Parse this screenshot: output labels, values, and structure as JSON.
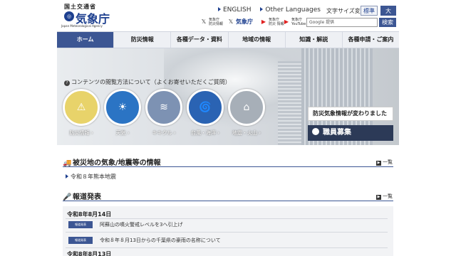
{
  "header": {
    "ministry": "国土交通省",
    "agency": "気象庁",
    "agency_en": "Japan Meteorological Agency",
    "links": {
      "english": "ENGLISH",
      "other_languages": "Other Languages"
    },
    "font_size_label": "文字サイズ変更",
    "font_standard": "標準",
    "font_large": "大",
    "social": [
      {
        "icon": "x-icon",
        "label": "気象庁\n防災情報"
      },
      {
        "icon": "x-icon",
        "label": "気象庁"
      },
      {
        "icon": "youtube-icon",
        "label": "気象庁\n防災 情報"
      },
      {
        "icon": "youtube-icon",
        "label": "気象庁\nYouTube"
      }
    ],
    "search_placeholder": "Google 提供",
    "search_button": "検索"
  },
  "nav": [
    "ホーム",
    "防災情報",
    "各種データ・資料",
    "地域の情報",
    "知識・解説",
    "各種申請・ご案内"
  ],
  "hero": {
    "question": "コンテンツの閲覧方法について（よくお寄せいただくご質問）",
    "circles": [
      {
        "label": "防災情報 ›",
        "icon": "warning-map-icon",
        "color": "#d8c24a"
      },
      {
        "label": "天気 ›",
        "icon": "sun-cloud-icon",
        "color": "#2b74c4"
      },
      {
        "label": "キキクル ›",
        "icon": "flood-icon",
        "color": "#7a8fb0"
      },
      {
        "label": "台風・海洋 ›",
        "icon": "typhoon-icon",
        "color": "#2a63b3"
      },
      {
        "label": "地震・火山 ›",
        "icon": "earthquake-icon",
        "color": "#9aa3ad"
      }
    ],
    "banner_info": "防災気象情報が変わりました",
    "banner_recruit": "職員募集"
  },
  "disaster": {
    "title": "被災地の気象/地震等の情報",
    "more": "一覧",
    "item": "令和８年熊本地震"
  },
  "press": {
    "title": "報道発表",
    "more": "一覧",
    "date1": "令和8年8月14日",
    "news": [
      {
        "badge": "報道発表",
        "text": "阿蘇山の噴火警戒レベルを3へ引上げ"
      },
      {
        "badge": "報道発表",
        "text": "令和８年８月13日からの千葉県の豪雨の名称について"
      }
    ],
    "date2": "令和8年8月13日"
  },
  "colors": {
    "brand": "#1d3f8f",
    "nav_active": "#3c5693",
    "recruit": "#2c3a57"
  }
}
